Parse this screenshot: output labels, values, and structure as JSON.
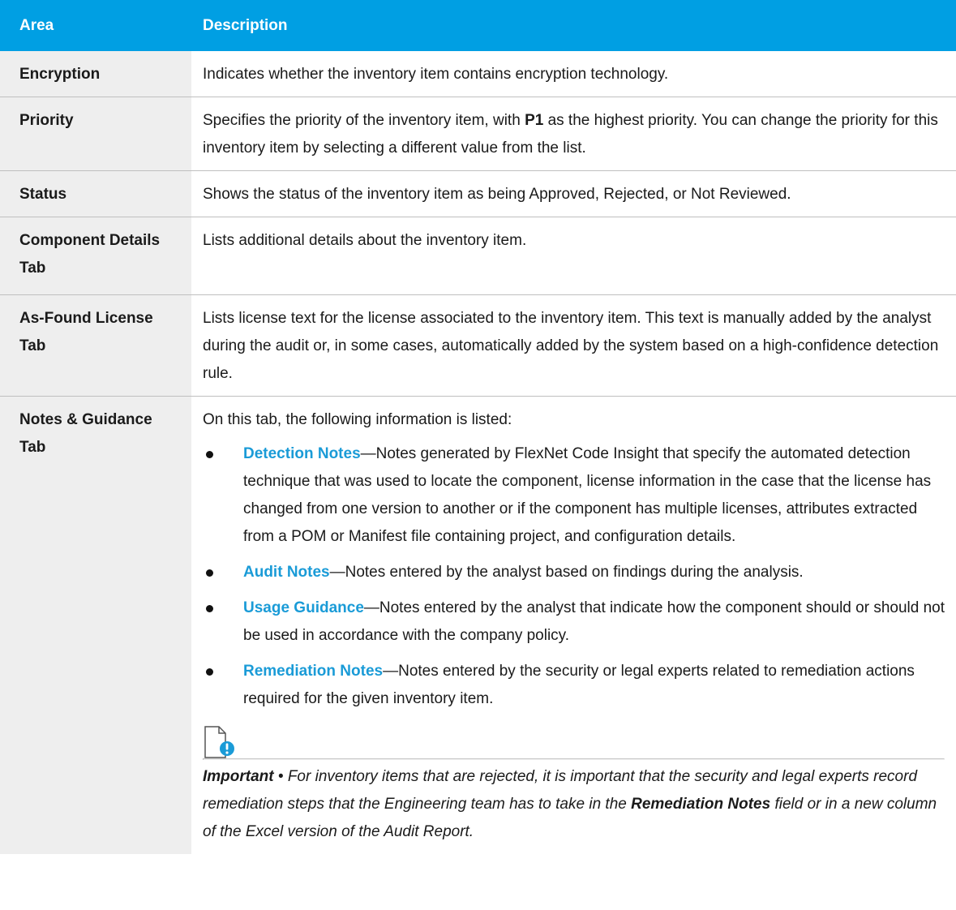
{
  "header": {
    "col_area": "Area",
    "col_description": "Description"
  },
  "rows": {
    "encryption": {
      "area": "Encryption",
      "desc": "Indicates whether the inventory item contains encryption technology."
    },
    "priority": {
      "area": "Priority",
      "desc_pre": "Specifies the priority of the inventory item, with ",
      "desc_bold": "P1",
      "desc_post": " as the highest priority. You can change the priority for this inventory item by selecting a different value from the list."
    },
    "status": {
      "area": "Status",
      "desc": "Shows the status of the inventory item as being Approved, Rejected, or Not Reviewed."
    },
    "component": {
      "area": "Component Details Tab",
      "desc": "Lists additional details about the inventory item."
    },
    "asfound": {
      "area": "As-Found License Tab",
      "desc": "Lists license text for the license associated to the inventory item. This text is manually added by the analyst during the audit or, in some cases, automatically added by the system based on a high-confidence detection rule."
    },
    "notes": {
      "area": "Notes & Guidance Tab",
      "intro": "On this tab, the following information is listed:",
      "items": [
        {
          "term": "Detection Notes",
          "text": "—Notes generated by FlexNet Code Insight that specify the automated detection technique that was used to locate the component, license information in the case that the license has changed from one version to another or if the component has multiple licenses, attributes extracted from a POM or Manifest file containing project, and configuration details."
        },
        {
          "term": "Audit Notes",
          "text": "—Notes entered by the analyst based on findings during the analysis."
        },
        {
          "term": "Usage Guidance",
          "text": "—Notes entered by the analyst that indicate how the component should or should not be used in accordance with the company policy."
        },
        {
          "term": "Remediation Notes",
          "text": "—Notes entered by the security or legal experts related to remediation actions required for the given inventory item."
        }
      ],
      "important": {
        "label": "Important",
        "separator": " • ",
        "text_pre": "For inventory items that are rejected, it is important that the security and legal experts record remediation steps that the Engineering team has to take in the ",
        "text_bold": "Remediation Notes",
        "text_post": " field or in a new column of the Excel version of the Audit Report."
      }
    }
  },
  "colors": {
    "header_bg": "#009fe3",
    "area_bg": "#eeeeee",
    "term": "#1a9bd7",
    "icon_accent": "#1a9bd7"
  },
  "icons": {
    "important": "important-note-icon"
  }
}
